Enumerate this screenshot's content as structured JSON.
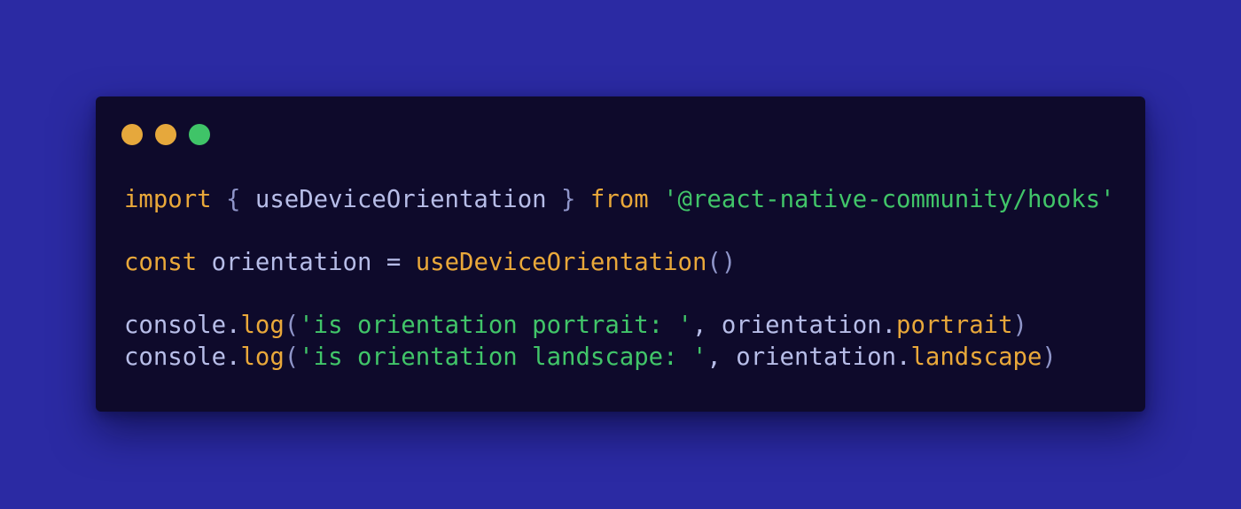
{
  "window_controls": {
    "close_color": "#e6a83c",
    "minimize_color": "#e6a83c",
    "maximize_color": "#3fc468"
  },
  "colors": {
    "page_background": "#2b2aa3",
    "window_background": "#0e0a2b",
    "keyword": "#e9a83a",
    "string": "#41c569",
    "identifier": "#b7bde8"
  },
  "code": {
    "line1": {
      "kw_import": "import",
      "brace_open": "{",
      "name": " useDeviceOrientation ",
      "brace_close": "}",
      "kw_from": "from",
      "module": "'@react-native-community/hooks'"
    },
    "line2": {
      "kw_const": "const",
      "var": " orientation ",
      "eq": "= ",
      "call": "useDeviceOrientation",
      "parens": "()"
    },
    "line3": {
      "obj": "console.",
      "method": "log",
      "open": "(",
      "str": "'is orientation portrait: '",
      "sep": ", orientation.",
      "prop": "portrait",
      "close": ")"
    },
    "line4": {
      "obj": "console.",
      "method": "log",
      "open": "(",
      "str": "'is orientation landscape: '",
      "sep": ", orientation.",
      "prop": "landscape",
      "close": ")"
    }
  }
}
